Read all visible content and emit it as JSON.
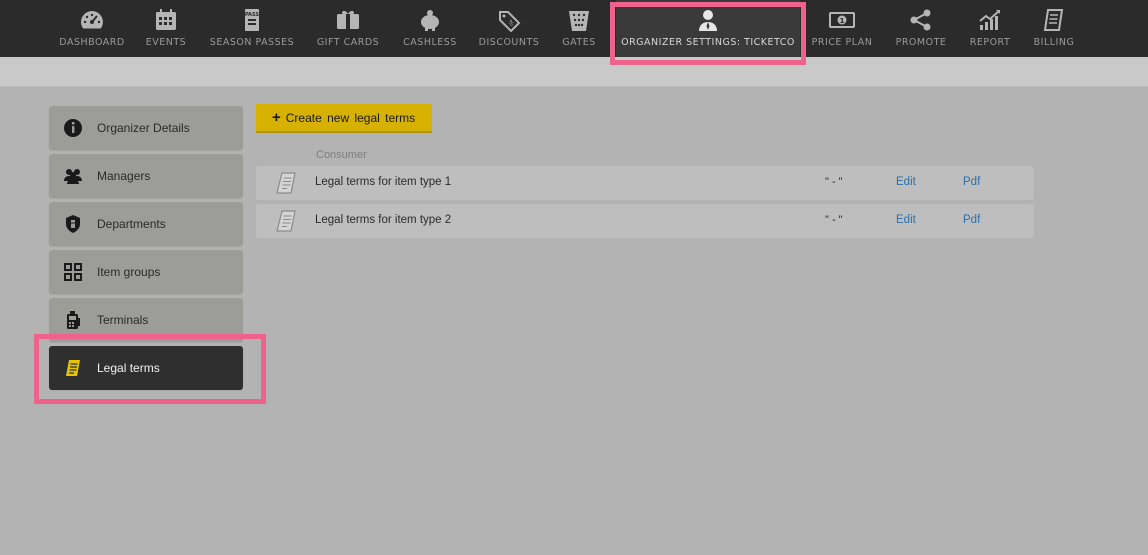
{
  "nav": {
    "items": [
      {
        "label": "DASHBOARD",
        "icon": "dashboard-gauge-icon"
      },
      {
        "label": "EVENTS",
        "icon": "calendar-icon"
      },
      {
        "label": "SEASON PASSES",
        "icon": "pass-ticket-icon"
      },
      {
        "label": "GIFT CARDS",
        "icon": "gift-card-icon"
      },
      {
        "label": "CASHLESS",
        "icon": "piggy-bank-icon"
      },
      {
        "label": "DISCOUNTS",
        "icon": "discount-tag-icon"
      },
      {
        "label": "GATES",
        "icon": "gate-icon"
      },
      {
        "label": "ORGANIZER SETTINGS: TICKETCO",
        "icon": "organizer-user-icon"
      },
      {
        "label": "PRICE PLAN",
        "icon": "banknote-icon"
      },
      {
        "label": "PROMOTE",
        "icon": "share-icon"
      },
      {
        "label": "REPORT",
        "icon": "chart-icon"
      },
      {
        "label": "BILLING",
        "icon": "invoice-icon"
      }
    ],
    "active_index": 7
  },
  "sidebar": {
    "items": [
      {
        "label": "Organizer Details",
        "icon": "info-icon"
      },
      {
        "label": "Managers",
        "icon": "users-icon"
      },
      {
        "label": "Departments",
        "icon": "shield-icon"
      },
      {
        "label": "Item groups",
        "icon": "grid-icon"
      },
      {
        "label": "Terminals",
        "icon": "terminal-icon"
      },
      {
        "label": "Legal terms",
        "icon": "document-icon"
      }
    ],
    "active_index": 5
  },
  "main": {
    "create_button_label": "Create new legal terms",
    "create_button_plus": "+",
    "column_header": "Consumer",
    "rows": [
      {
        "name": "Legal terms for item type 1",
        "value": "\" - \"",
        "edit": "Edit",
        "pdf": "Pdf"
      },
      {
        "name": "Legal terms for item type 2",
        "value": "\" - \"",
        "edit": "Edit",
        "pdf": "Pdf"
      }
    ]
  },
  "colors": {
    "topbar": "#2b2b2b",
    "background": "#b3b3b3",
    "sidebar_item": "#9c9c98",
    "sidebar_active": "#2f2f2f",
    "accent_yellow": "#d6b100",
    "link_blue": "#2c6fa8",
    "highlight_pink": "#f0628c"
  }
}
